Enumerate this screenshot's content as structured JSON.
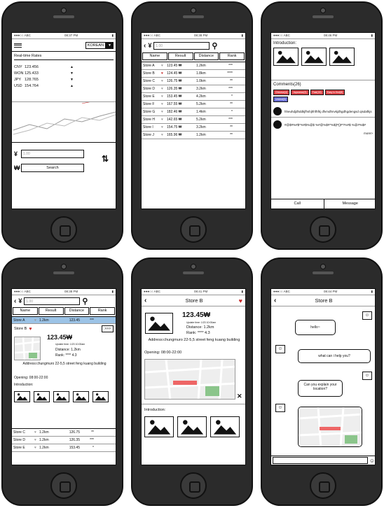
{
  "colors": {
    "accent": "#c62828",
    "tag_red": "#e0464a",
    "tag_blue": "#6a6fd6",
    "highlight": "#9cc3e6"
  },
  "status": {
    "carrier": "●●●○○ ABC",
    "battery": "▮"
  },
  "screen1": {
    "time": "08:37 PM",
    "lang": "KOREAN",
    "rates_title": "Real-time Rates",
    "rates": [
      {
        "cur": "CNY",
        "val": "123.456",
        "dir": "up"
      },
      {
        "cur": "WON",
        "val": "125.433",
        "dir": "down"
      },
      {
        "cur": "JPY",
        "val": "128.765",
        "dir": "down"
      },
      {
        "cur": "USD",
        "val": "154.764",
        "dir": "up"
      }
    ],
    "yen": "¥",
    "won": "₩",
    "input_value": "1.00",
    "search_label": "Search"
  },
  "screen2": {
    "time": "08:38 PM",
    "yen": "¥",
    "input_value": "1.00",
    "tabs": [
      "Name",
      "Result",
      "Distance",
      "Rank"
    ],
    "rows": [
      {
        "name": "Store A",
        "fav": false,
        "result": "123.45 ₩",
        "dist": "1.2km",
        "rank": "***"
      },
      {
        "name": "Store B",
        "fav": true,
        "result": "124.45 ₩",
        "dist": "1.8km",
        "rank": "****"
      },
      {
        "name": "Store C",
        "fav": false,
        "result": "126.75 ₩",
        "dist": "1.0km",
        "rank": "**"
      },
      {
        "name": "Store D",
        "fav": false,
        "result": "126.35 ₩",
        "dist": "3.2km",
        "rank": "***"
      },
      {
        "name": "Store E",
        "fav": false,
        "result": "153.45 ₩",
        "dist": "4.2km",
        "rank": "*"
      },
      {
        "name": "Store F",
        "fav": false,
        "result": "167.55 ₩",
        "dist": "5.2km",
        "rank": "**"
      },
      {
        "name": "Store G",
        "fav": false,
        "result": "182.46 ₩",
        "dist": "1.4km",
        "rank": "*"
      },
      {
        "name": "Store H",
        "fav": false,
        "result": "142.65 ₩",
        "dist": "5.2km",
        "rank": "***"
      },
      {
        "name": "Store I",
        "fav": false,
        "result": "154.75 ₩",
        "dist": "3.2km",
        "rank": "**"
      },
      {
        "name": "Store J",
        "fav": false,
        "result": "165.96 ₩",
        "dist": "1.2km",
        "rank": "**"
      }
    ]
  },
  "screen3": {
    "time": "08:46 PM",
    "intro_title": "Introduction:",
    "comments_title": "Comments(26)",
    "tags": [
      {
        "label": "Chinese(4)",
        "color": "red"
      },
      {
        "label": "Japanese(5)",
        "color": "red"
      },
      {
        "label": "Fast(18)",
        "color": "red"
      },
      {
        "label": "Easy to find(8)",
        "color": "red"
      },
      {
        "label": "Unkind(3)",
        "color": "blue"
      }
    ],
    "comment1": "hheuhdjdhddkjfhshjhhfhfkj dfvmdhnvkjdhgdhgdengsd qisdafkjs",
    "comment2": "#@$#%#$*%#$%@$ %#@%$#*%$(P()P?%#$ %@#%$#",
    "more": "more>",
    "call": "Call",
    "message": "Message"
  },
  "screen4": {
    "time": "08:38 PM",
    "yen": "¥",
    "input_value": "1.00",
    "tabs": [
      "Name",
      "Result",
      "Distance",
      "Rank"
    ],
    "highlight_row": {
      "name": "Store A",
      "dist": "1.2km",
      "result": "123.45",
      "rank": "***"
    },
    "store_b": "Store B",
    "more": ">>>",
    "price": "123.45₩",
    "update": "Update time: 1/23 10:00am",
    "distance": "Distance: 1.2km",
    "rank": "Rank: **** 4.3",
    "address": "Address:chungmuro 22-5,5 street feng kuang building",
    "opening": "Opening: 08:00-22:00",
    "intro": "Introduction:",
    "rows": [
      {
        "name": "Store C",
        "dist": "1.2km",
        "result": "126.75",
        "rank": "**"
      },
      {
        "name": "Store D",
        "dist": "1.2km",
        "result": "126.35",
        "rank": "***"
      },
      {
        "name": "Store E",
        "dist": "1.2km",
        "result": "153.45",
        "rank": "*"
      }
    ]
  },
  "screen5": {
    "time": "08:41 PM",
    "title": "Store B",
    "price": "123.45₩",
    "update": "Update time: 1/23 10:00am",
    "distance": "Distance: 1.2km",
    "rank": "Rank: **** 4.3",
    "address": "Address:chungmuro 22-5,5 street feng kuang building",
    "opening": "Opening: 08:00-22:00",
    "intro": "Introduction:"
  },
  "screen6": {
    "time": "08:44 PM",
    "title": "Store B",
    "msg1": "hello~",
    "msg2": "what can i help you?",
    "msg3": "Can you explain your location?"
  }
}
